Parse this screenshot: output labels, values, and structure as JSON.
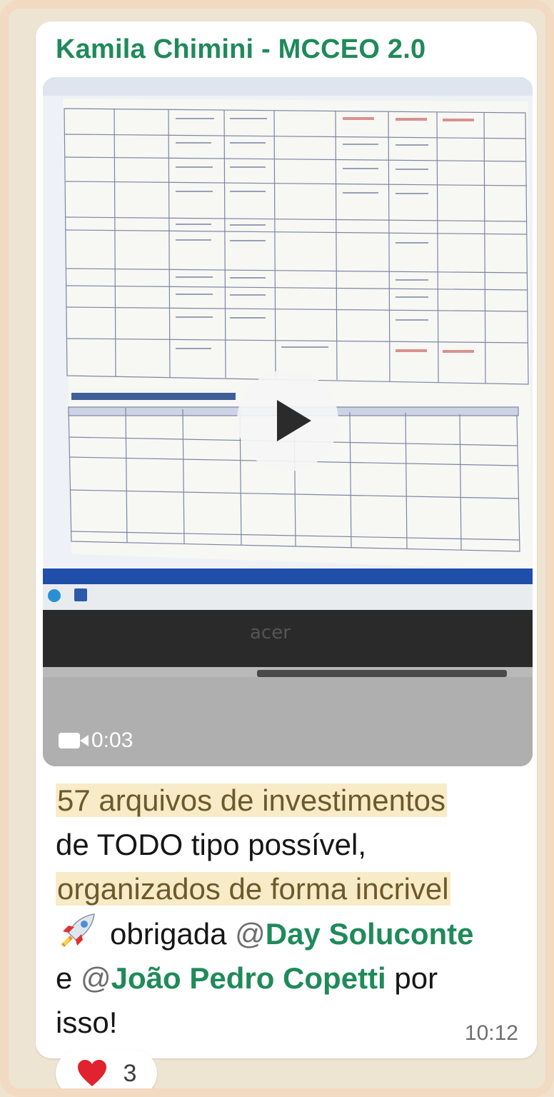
{
  "chat": {
    "sender_name": "Kamila Chimini - MCCEO 2.0"
  },
  "video": {
    "duration": "0:03",
    "camera_icon": "video-camera-icon",
    "play_icon": "play-icon"
  },
  "message": {
    "line1": "57 arquivos de investimentos",
    "line2": "de TODO tipo possível,",
    "line3": "organizados de forma incrivel",
    "thanks": "obrigada",
    "at1": "@",
    "mention1": "Day Soluconte",
    "connector": "e",
    "at2": "@",
    "mention2": "João Pedro Copetti",
    "suffix": "por",
    "ending": "isso!",
    "emoji": "rocket-icon",
    "time": "10:12"
  },
  "reaction": {
    "emoji": "heart-icon",
    "count": "3"
  },
  "colors": {
    "sender": "#1f8a5a",
    "highlight_bg": "#f8ebc7",
    "mention": "#1f8a5a",
    "frame": "#f2d9c2"
  }
}
